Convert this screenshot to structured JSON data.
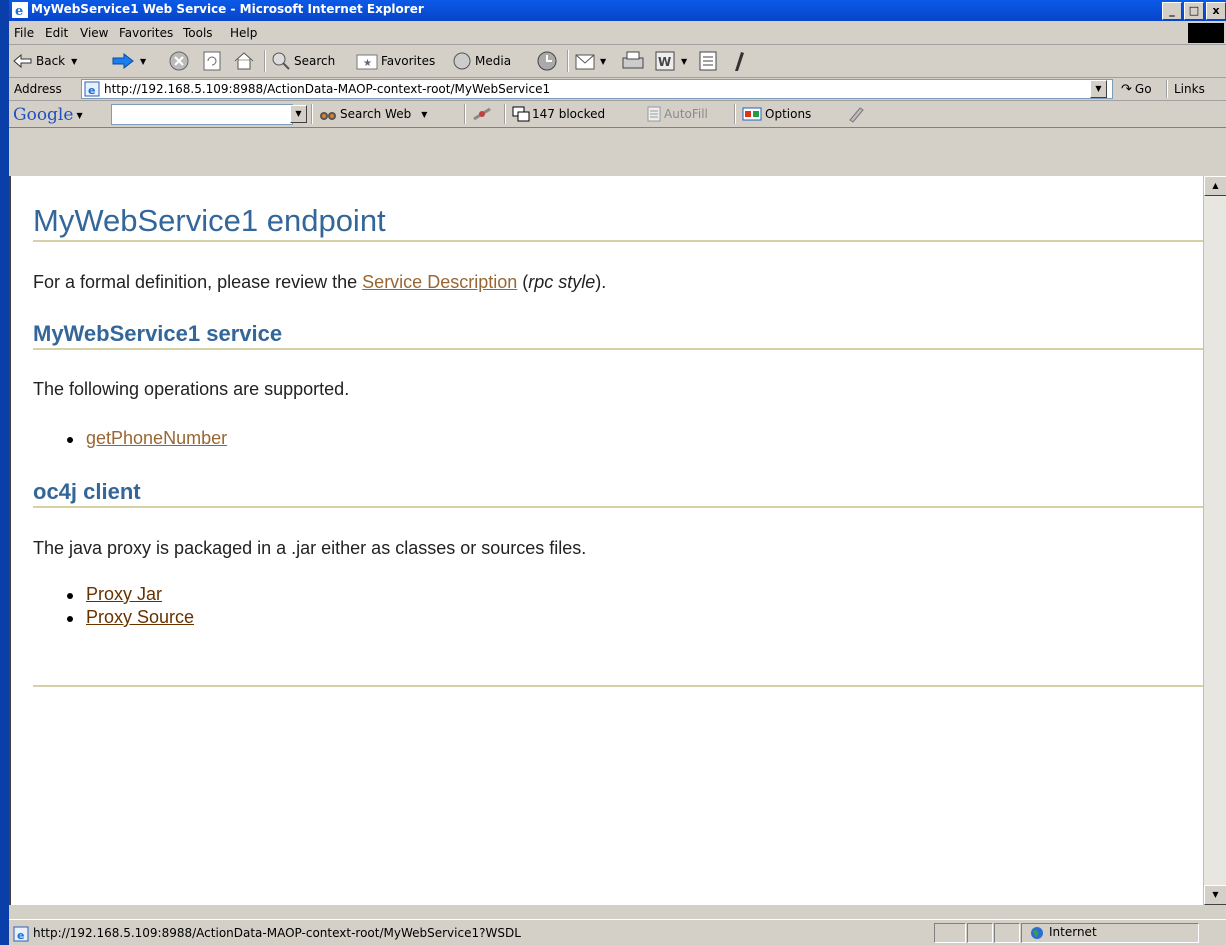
{
  "window": {
    "title": "MyWebService1 Web Service - Microsoft Internet Explorer"
  },
  "menu": [
    "File",
    "Edit",
    "View",
    "Favorites",
    "Tools",
    "Help"
  ],
  "toolbar": {
    "back": "Back",
    "search": "Search",
    "favorites": "Favorites",
    "media": "Media"
  },
  "address": {
    "label": "Address",
    "url": "http://192.168.5.109:8988/ActionData-MAOP-context-root/MyWebService1",
    "go": "Go",
    "links": "Links"
  },
  "google": {
    "brand": "Google",
    "search_web": "Search Web",
    "blocked": "147 blocked",
    "autofill": "AutoFill",
    "options": "Options"
  },
  "page": {
    "title": "MyWebService1 endpoint",
    "intro_prefix": "For a formal definition, please review the ",
    "intro_link": "Service Description",
    "intro_open": " (",
    "intro_style": "rpc style",
    "intro_close": ").",
    "service_heading": "MyWebService1 service",
    "ops_text": "The following operations are supported.",
    "operations": [
      "getPhoneNumber"
    ],
    "client_heading": "oc4j client",
    "client_text": "The java proxy is packaged in a .jar either as classes or sources files.",
    "client_links": [
      "Proxy Jar",
      "Proxy Source"
    ]
  },
  "status": {
    "url": "http://192.168.5.109:8988/ActionData-MAOP-context-root/MyWebService1?WSDL",
    "zone": "Internet"
  },
  "colors": {
    "heading": "#336699",
    "link": "#996633",
    "rule": "#d6d0a4",
    "titlebar": "#0a5ae8"
  }
}
